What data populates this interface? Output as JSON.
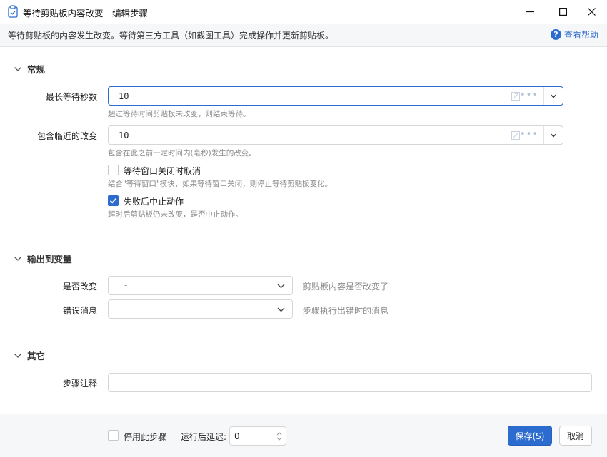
{
  "window": {
    "title": "等待剪贴板内容改变  -  编辑步骤"
  },
  "description": {
    "text": "等待剪贴板的内容发生改变。等待第三方工具（如截图工具）完成操作并更新剪贴板。",
    "help_label": "查看帮助",
    "help_glyph": "?"
  },
  "general": {
    "section_title": "常规",
    "max_wait": {
      "label": "最长等待秒数",
      "value": "10",
      "hint": "超过等待时间剪贴板未改变，则结束等待。"
    },
    "include_recent": {
      "label": "包含临近的改变",
      "value": "10",
      "hint": "包含在此之前一定时间内(毫秒)发生的改变。"
    },
    "cancel_on_close": {
      "label": "等待窗口关闭时取消",
      "checked": false,
      "hint": "结合\"等待窗口\"模块，如果等待窗口关闭，则停止等待剪贴板变化。"
    },
    "stop_on_fail": {
      "label": "失败后中止动作",
      "checked": true,
      "hint": "超时后剪贴板仍未改变，是否中止动作。"
    },
    "dots": "•••"
  },
  "output": {
    "section_title": "输出到变量",
    "changed": {
      "label": "是否改变",
      "value": "-",
      "hint": "剪贴板内容是否改变了"
    },
    "error": {
      "label": "错误消息",
      "value": "-",
      "hint": "步骤执行出错时的消息"
    }
  },
  "other": {
    "section_title": "其它",
    "note_label": "步骤注释",
    "note_value": ""
  },
  "footer": {
    "disable_label": "停用此步骤",
    "disable_checked": false,
    "delay_label": "运行后延迟:",
    "delay_value": "0",
    "save_label": "保存(S)",
    "cancel_label": "取消"
  },
  "colors": {
    "accent": "#2d6ccf",
    "description_bg": "#f6f7f9"
  }
}
